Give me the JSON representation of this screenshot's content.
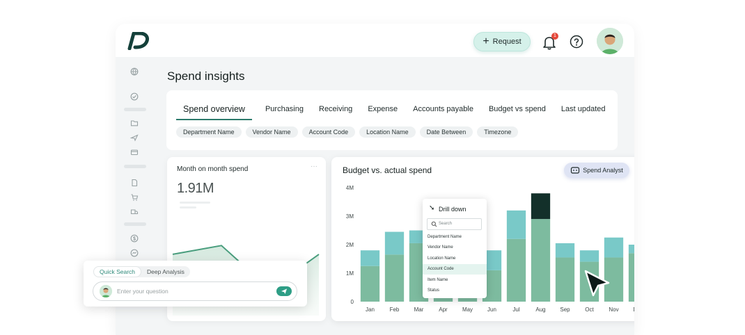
{
  "colors": {
    "accent": "#2c7a6b",
    "budget": "#79c9c8",
    "actual": "#7dbb9f",
    "highlight": "#13302a",
    "line": "#4a9e7e"
  },
  "header": {
    "request_label": "Request",
    "notification_count": "1"
  },
  "page": {
    "title": "Spend insights"
  },
  "tabs": [
    {
      "label": "Spend overview",
      "active": true
    },
    {
      "label": "Purchasing"
    },
    {
      "label": "Receiving"
    },
    {
      "label": "Expense"
    },
    {
      "label": "Accounts payable"
    },
    {
      "label": "Budget vs spend"
    },
    {
      "label": "Last updated"
    }
  ],
  "filters": [
    "Department Name",
    "Vendor Name",
    "Account Code",
    "Location Name",
    "Date Between",
    "Timezone"
  ],
  "mom_card": {
    "title": "Month on month spend",
    "value": "1.91M",
    "more": "···",
    "series": [
      0.62,
      0.72,
      0.22,
      0.62
    ]
  },
  "budget_card": {
    "title": "Budget vs. actual spend",
    "analyst_label": "Spend Analyst",
    "more": "···"
  },
  "chart_data": {
    "type": "bar",
    "stacked": true,
    "categories": [
      "Jan",
      "Feb",
      "Mar",
      "Apr",
      "May",
      "Jun",
      "Jul",
      "Aug",
      "Sep",
      "Oct",
      "Nov",
      "Dec"
    ],
    "y_ticks": [
      "0",
      "1M",
      "2M",
      "3M",
      "4M"
    ],
    "ylim": [
      0,
      4000000
    ],
    "series": [
      {
        "values": [
          1250000,
          1650000,
          2050000,
          2300000,
          1450000,
          1100000,
          2200000,
          2900000,
          1550000,
          1400000,
          1550000,
          1700000
        ]
      },
      {
        "values": [
          550000,
          800000,
          450000,
          1100000,
          1000000,
          700000,
          1000000,
          900000,
          500000,
          400000,
          700000,
          300000
        ]
      }
    ],
    "highlight_index": 7
  },
  "drill_down": {
    "title": "Drill down",
    "search_placeholder": "Search",
    "items": [
      "Department Name",
      "Vendor Name",
      "Location Name",
      "Account Code",
      "Item Name",
      "Status"
    ],
    "selected_index": 3
  },
  "search": {
    "modes": [
      "Quick Search",
      "Deep Analysis"
    ],
    "active_mode": 0,
    "placeholder": "Enter your question"
  }
}
